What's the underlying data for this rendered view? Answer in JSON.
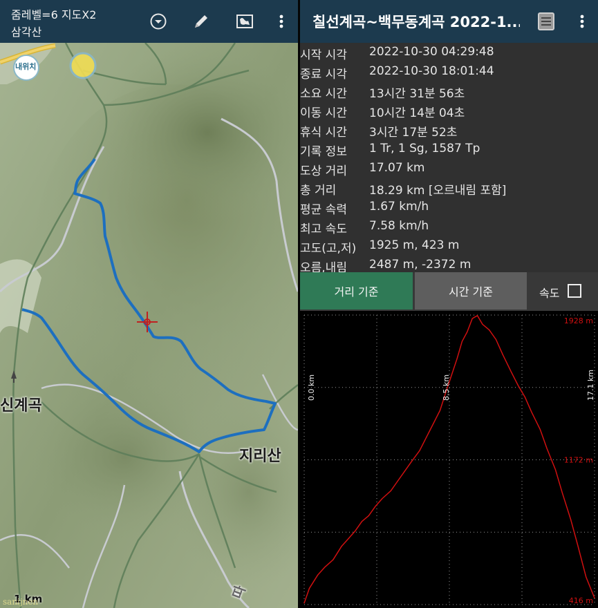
{
  "left_panel": {
    "header": {
      "title_line1": "줌레벨=6 지도X2",
      "title_line2": "삼각산",
      "icons": [
        "chevron-down-circle-icon",
        "pencil-icon",
        "map-icon",
        "more-vert-icon"
      ]
    },
    "map": {
      "labels": {
        "place_left": "신계곡",
        "place_right": "지리산",
        "badge": "내위치",
        "partial": "따"
      },
      "scale_label": "1 km",
      "watermark": "sanijnen"
    }
  },
  "right_panel": {
    "header": {
      "title": "칠선계곡~백무동계곡 2022-1...",
      "icons": [
        "list-view-icon",
        "more-vert-icon"
      ]
    },
    "stats": [
      {
        "label": "시작 시각",
        "value": "2022-10-30 04:29:48"
      },
      {
        "label": "종료 시각",
        "value": "2022-10-30 18:01:44"
      },
      {
        "label": "소요 시간",
        "value": "13시간 31분 56초"
      },
      {
        "label": "이동 시간",
        "value": "10시간 14분 04초"
      },
      {
        "label": "휴식 시간",
        "value": "3시간 17분 52초"
      },
      {
        "label": "기록 정보",
        "value": "1 Tr, 1 Sg, 1587 Tp"
      },
      {
        "label": "도상 거리",
        "value": "17.07 km"
      },
      {
        "label": "총 거리",
        "value": "18.29 km [오르내림 포함]"
      },
      {
        "label": "평균 속력",
        "value": "1.67 km/h"
      },
      {
        "label": "최고 속도",
        "value": "7.58 km/h"
      },
      {
        "label": "고도(고,저)",
        "value": "1925 m, 423 m"
      },
      {
        "label": "오름,내림",
        "value": "2487 m, -2372 m"
      }
    ],
    "toggles": {
      "distance_basis": "거리 기준",
      "time_basis": "시간 기준",
      "speed_label": "속도",
      "speed_checked": false
    }
  },
  "chart_data": {
    "type": "line",
    "title": "",
    "xlabel": "",
    "ylabel": "",
    "xlim": [
      0,
      17.1
    ],
    "ylim": [
      416,
      1928
    ],
    "x_tick_labels": [
      "0.0 km",
      "8.5 km",
      "17.1 km"
    ],
    "y_tick_labels": [
      "1928 m",
      "1172 m",
      "416 m"
    ],
    "grid": true,
    "series": [
      {
        "color": "#d01010",
        "x": [
          0.0,
          0.3,
          0.8,
          1.2,
          1.7,
          2.2,
          2.6,
          3.0,
          3.4,
          3.8,
          4.2,
          4.6,
          5.1,
          5.5,
          5.9,
          6.3,
          6.8,
          7.2,
          7.6,
          8.0,
          8.4,
          8.7,
          9.0,
          9.3,
          9.6,
          9.9,
          10.2,
          10.5,
          10.9,
          11.3,
          11.7,
          12.2,
          12.6,
          13.0,
          13.4,
          13.9,
          14.3,
          14.8,
          15.2,
          15.7,
          16.1,
          16.6,
          17.1
        ],
        "y": [
          423,
          500,
          570,
          610,
          650,
          720,
          760,
          800,
          850,
          880,
          930,
          970,
          1010,
          1060,
          1110,
          1160,
          1220,
          1290,
          1360,
          1430,
          1540,
          1620,
          1700,
          1790,
          1840,
          1910,
          1925,
          1880,
          1850,
          1800,
          1720,
          1630,
          1560,
          1500,
          1420,
          1330,
          1230,
          1120,
          1000,
          860,
          730,
          560,
          450
        ]
      }
    ]
  }
}
